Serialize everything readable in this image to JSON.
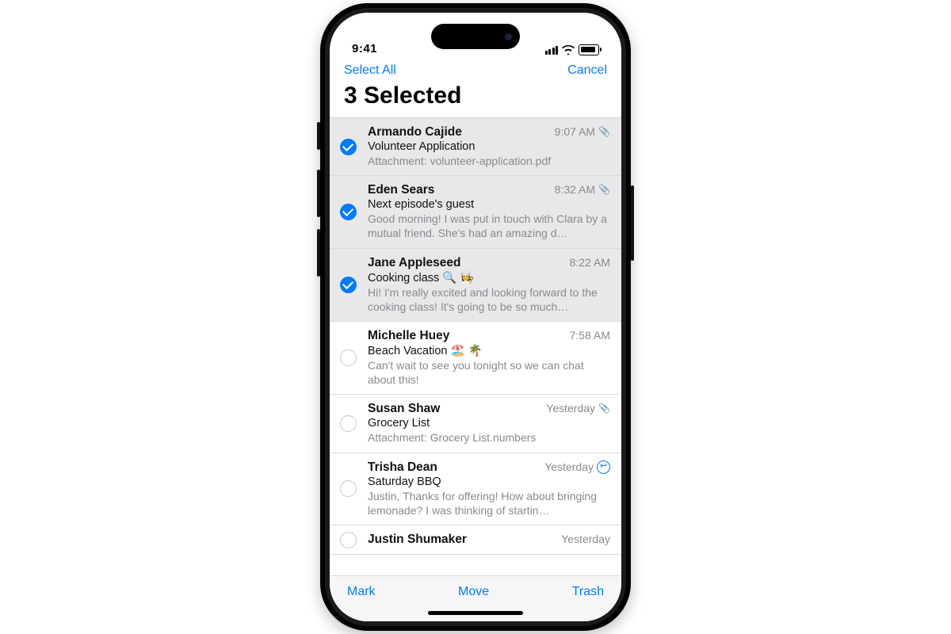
{
  "status": {
    "time": "9:41"
  },
  "nav": {
    "select_all": "Select All",
    "cancel": "Cancel"
  },
  "header": {
    "title": "3 Selected"
  },
  "messages": [
    {
      "sender": "Armando Cajide",
      "time": "9:07 AM",
      "attachment": true,
      "reply": false,
      "subject": "Volunteer Application",
      "preview": "Attachment: volunteer-application.pdf",
      "selected": true
    },
    {
      "sender": "Eden Sears",
      "time": "8:32 AM",
      "attachment": true,
      "reply": false,
      "subject": "Next episode's guest",
      "preview": "Good morning! I was put in touch with Clara by a mutual friend. She's had an amazing d…",
      "selected": true
    },
    {
      "sender": "Jane Appleseed",
      "time": "8:22 AM",
      "attachment": false,
      "reply": false,
      "subject": "Cooking class 🔍 👩‍🍳",
      "preview": "Hi! I'm really excited and looking forward to the cooking class! It's going to be so much…",
      "selected": true
    },
    {
      "sender": "Michelle Huey",
      "time": "7:58 AM",
      "attachment": false,
      "reply": false,
      "subject": "Beach Vacation 🏖️ 🌴",
      "preview": "Can't wait to see you tonight so we can chat about this!",
      "selected": false
    },
    {
      "sender": "Susan Shaw",
      "time": "Yesterday",
      "attachment": true,
      "reply": false,
      "subject": "Grocery List",
      "preview": "Attachment: Grocery List.numbers",
      "selected": false
    },
    {
      "sender": "Trisha Dean",
      "time": "Yesterday",
      "attachment": false,
      "reply": true,
      "subject": "Saturday BBQ",
      "preview": "Justin, Thanks for offering! How about bringing lemonade? I was thinking of startin…",
      "selected": false
    },
    {
      "sender": "Justin Shumaker",
      "time": "Yesterday",
      "attachment": false,
      "reply": false,
      "subject": "",
      "preview": "",
      "selected": false
    }
  ],
  "toolbar": {
    "mark": "Mark",
    "move": "Move",
    "trash": "Trash"
  }
}
